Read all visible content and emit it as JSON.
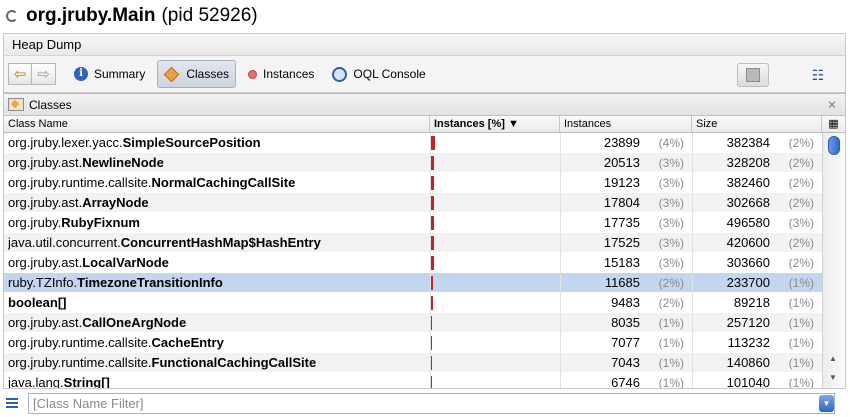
{
  "window": {
    "app_name": "org.jruby.Main",
    "pid_label": "(pid 52926)"
  },
  "subtab": {
    "label": "Heap Dump"
  },
  "toolbar": {
    "tabs": [
      {
        "label": "Summary",
        "icon": "info-icon"
      },
      {
        "label": "Classes",
        "icon": "classes-icon",
        "active": true
      },
      {
        "label": "Instances",
        "icon": "instances-icon"
      },
      {
        "label": "OQL Console",
        "icon": "oql-icon"
      }
    ]
  },
  "panel": {
    "title": "Classes"
  },
  "table": {
    "columns": {
      "name": "Class Name",
      "instances_pct": "Instances [%]",
      "instances": "Instances",
      "size": "Size",
      "sort_indicator": "▼"
    },
    "rows": [
      {
        "pkg": "org.jruby.lexer.yacc.",
        "cls": "SimpleSourcePosition",
        "instances": "23899",
        "inst_pct": "(4%)",
        "size": "382384",
        "size_pct": "(2%)",
        "bar": 4
      },
      {
        "pkg": "org.jruby.ast.",
        "cls": "NewlineNode",
        "instances": "20513",
        "inst_pct": "(3%)",
        "size": "328208",
        "size_pct": "(2%)",
        "bar": 3
      },
      {
        "pkg": "org.jruby.runtime.callsite.",
        "cls": "NormalCachingCallSite",
        "instances": "19123",
        "inst_pct": "(3%)",
        "size": "382460",
        "size_pct": "(2%)",
        "bar": 3
      },
      {
        "pkg": "org.jruby.ast.",
        "cls": "ArrayNode",
        "instances": "17804",
        "inst_pct": "(3%)",
        "size": "302668",
        "size_pct": "(2%)",
        "bar": 3
      },
      {
        "pkg": "org.jruby.",
        "cls": "RubyFixnum",
        "instances": "17735",
        "inst_pct": "(3%)",
        "size": "496580",
        "size_pct": "(3%)",
        "bar": 3
      },
      {
        "pkg": "java.util.concurrent.",
        "cls": "ConcurrentHashMap$HashEntry",
        "instances": "17525",
        "inst_pct": "(3%)",
        "size": "420600",
        "size_pct": "(2%)",
        "bar": 3
      },
      {
        "pkg": "org.jruby.ast.",
        "cls": "LocalVarNode",
        "instances": "15183",
        "inst_pct": "(3%)",
        "size": "303660",
        "size_pct": "(2%)",
        "bar": 3
      },
      {
        "pkg": "ruby.TZInfo.",
        "cls": "TimezoneTransitionInfo",
        "instances": "11685",
        "inst_pct": "(2%)",
        "size": "233700",
        "size_pct": "(1%)",
        "bar": 2,
        "selected": true
      },
      {
        "pkg": "",
        "cls": "boolean[]",
        "instances": "9483",
        "inst_pct": "(2%)",
        "size": "89218",
        "size_pct": "(1%)",
        "bar": 2
      },
      {
        "pkg": "org.jruby.ast.",
        "cls": "CallOneArgNode",
        "instances": "8035",
        "inst_pct": "(1%)",
        "size": "257120",
        "size_pct": "(1%)",
        "bar": 1
      },
      {
        "pkg": "org.jruby.runtime.callsite.",
        "cls": "CacheEntry",
        "instances": "7077",
        "inst_pct": "(1%)",
        "size": "113232",
        "size_pct": "(1%)",
        "bar": 1
      },
      {
        "pkg": "org.jruby.runtime.callsite.",
        "cls": "FunctionalCachingCallSite",
        "instances": "7043",
        "inst_pct": "(1%)",
        "size": "140860",
        "size_pct": "(1%)",
        "bar": 1
      },
      {
        "pkg": "java.lang.",
        "cls": "String[]",
        "instances": "6746",
        "inst_pct": "(1%)",
        "size": "101040",
        "size_pct": "(1%)",
        "bar": 1
      }
    ]
  },
  "filter": {
    "placeholder": "[Class Name Filter]",
    "value": ""
  },
  "colors": {
    "bar": "#c0242a",
    "selection": "#c3d5ef",
    "scroll_thumb": "#2f6ac8"
  }
}
